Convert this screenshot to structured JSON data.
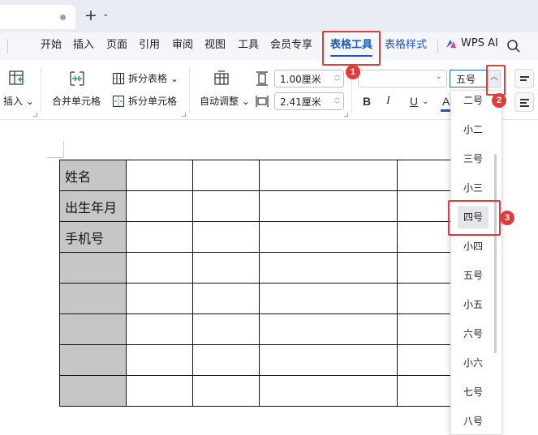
{
  "tabbar": {
    "new_tab_label": "+",
    "new_tab_menu": "⌄"
  },
  "menu": {
    "items": [
      "开始",
      "插入",
      "页面",
      "引用",
      "审阅",
      "视图",
      "工具",
      "会员专享"
    ],
    "active_tab": "表格工具",
    "table_style_tab": "表格样式",
    "wps_ai": "WPS AI"
  },
  "ribbon": {
    "insert_label": "插入",
    "merge_cells": "合并单元格",
    "split_table": "拆分表格",
    "split_cells": "拆分单元格",
    "auto_adjust": "自动调整",
    "row_height": "1.00厘米",
    "col_width": "2.41厘米",
    "font_size_value": "五号",
    "bold": "B",
    "italic": "I",
    "underline": "U",
    "underline_menu": "⌄",
    "font_color": "A"
  },
  "table": {
    "rows": [
      [
        "姓名",
        "",
        "",
        "",
        ""
      ],
      [
        "出生年月",
        "",
        "",
        "",
        ""
      ],
      [
        "手机号",
        "",
        "",
        "",
        ""
      ],
      [
        "",
        "",
        "",
        "",
        ""
      ],
      [
        "",
        "",
        "",
        "",
        ""
      ],
      [
        "",
        "",
        "",
        "",
        ""
      ],
      [
        "",
        "",
        "",
        "",
        ""
      ],
      [
        "",
        "",
        "",
        "",
        ""
      ]
    ]
  },
  "font_size_menu": {
    "options": [
      "二号",
      "小二",
      "三号",
      "小三",
      "四号",
      "小四",
      "五号",
      "小五",
      "六号",
      "小六",
      "七号",
      "八号"
    ],
    "highlighted": "四号"
  },
  "annotations": {
    "step1": "1",
    "step2": "2",
    "step3": "3"
  },
  "colors": {
    "accent": "#1a56c8",
    "annotation": "#e03c3c",
    "header_fill": "#c6c6c6",
    "font_color_bar": "#1a56c8"
  }
}
